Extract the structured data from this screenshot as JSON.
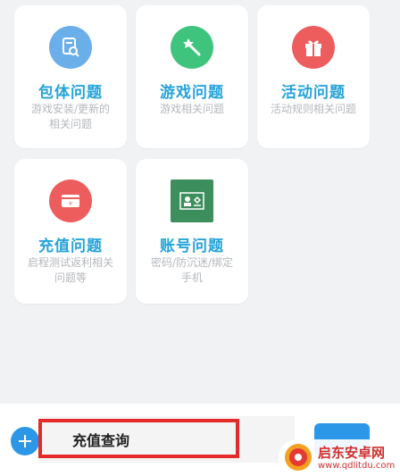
{
  "categories": [
    {
      "title": "包体问题",
      "desc": "游戏安装/更新的相关问题",
      "icon": "package-search-icon",
      "color": "#6aaeea"
    },
    {
      "title": "游戏问题",
      "desc": "游戏相关问题",
      "icon": "magic-wand-icon",
      "color": "#3fc47e"
    },
    {
      "title": "活动问题",
      "desc": "活动规则相关问题",
      "icon": "gift-icon",
      "color": "#ee5d5d"
    },
    {
      "title": "充值问题",
      "desc": "启程测试返利相关问题等",
      "icon": "recharge-card-icon",
      "color": "#ee5d5d"
    },
    {
      "title": "账号问题",
      "desc": "密码/防沉迷/绑定手机",
      "icon": "id-card-icon",
      "color": "#3c8e5c"
    }
  ],
  "input": {
    "value": "充值查询"
  },
  "send_button": {
    "label": ""
  },
  "watermark": {
    "name": "启东安卓网",
    "url": "www.qdlitdu.com"
  },
  "colors": {
    "accent": "#2b97e6",
    "title": "#25a3d9",
    "highlight": "#e52a2a"
  }
}
